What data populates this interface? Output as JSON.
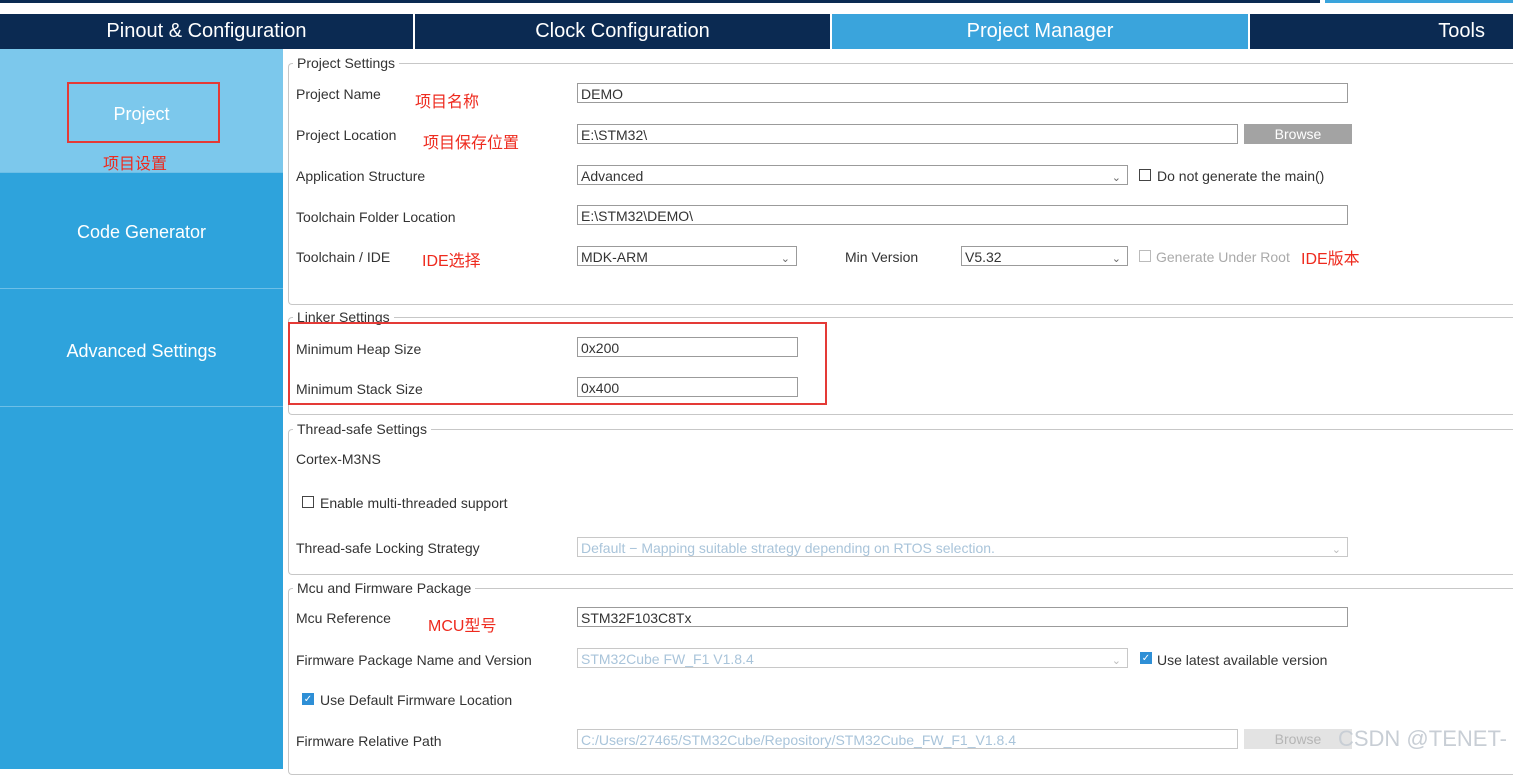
{
  "tabs": [
    {
      "label": "Pinout & Configuration"
    },
    {
      "label": "Clock Configuration"
    },
    {
      "label": "Project Manager"
    },
    {
      "label": "Tools"
    }
  ],
  "sidebar": {
    "items": [
      {
        "label": "Project"
      },
      {
        "label": "Code Generator"
      },
      {
        "label": "Advanced Settings"
      }
    ]
  },
  "annotations": {
    "project_settings_note": "项目设置",
    "project_name_note": "项目名称",
    "project_location_note": "项目保存位置",
    "ide_note": "IDE选择",
    "ide_version_note": "IDE版本",
    "mcu_note": "MCU型号"
  },
  "project_settings": {
    "legend": "Project Settings",
    "project_name_label": "Project Name",
    "project_name_value": "DEMO",
    "project_location_label": "Project Location",
    "project_location_value": "E:\\STM32\\",
    "browse_label": "Browse",
    "app_structure_label": "Application Structure",
    "app_structure_value": "Advanced",
    "no_main_label": "Do not generate the main()",
    "toolchain_folder_label": "Toolchain Folder Location",
    "toolchain_folder_value": "E:\\STM32\\DEMO\\",
    "toolchain_label": "Toolchain / IDE",
    "toolchain_value": "MDK-ARM",
    "min_version_label": "Min Version",
    "min_version_value": "V5.32",
    "generate_root_label": "Generate Under Root"
  },
  "linker_settings": {
    "legend": "Linker Settings",
    "heap_label": "Minimum Heap Size",
    "heap_value": "0x200",
    "stack_label": "Minimum Stack Size",
    "stack_value": "0x400"
  },
  "thread_settings": {
    "legend": "Thread-safe Settings",
    "core": "Cortex-M3NS",
    "multithread_label": "Enable multi-threaded support",
    "locking_label": "Thread-safe Locking Strategy",
    "locking_value": "Default  −  Mapping suitable strategy depending on RTOS selection."
  },
  "mcu_package": {
    "legend": "Mcu and Firmware Package",
    "mcu_ref_label": "Mcu Reference",
    "mcu_ref_value": "STM32F103C8Tx",
    "fw_name_label": "Firmware Package Name and Version",
    "fw_name_value": "STM32Cube FW_F1 V1.8.4",
    "use_latest_label": "Use latest available version",
    "default_location_label": "Use Default Firmware Location",
    "fw_path_label": "Firmware Relative Path",
    "fw_path_value": "C:/Users/27465/STM32Cube/Repository/STM32Cube_FW_F1_V1.8.4",
    "browse_label": "Browse"
  },
  "watermark": "CSDN @TENET-",
  "colors": {
    "topbar": "#0b2a52",
    "active_tab": "#3aa4dc",
    "sidebar": "#2ea3dc",
    "sidebar_active": "#7cc8ec",
    "annotation": "#ee2a1e",
    "checkbox_checked": "#2e8fd6"
  }
}
